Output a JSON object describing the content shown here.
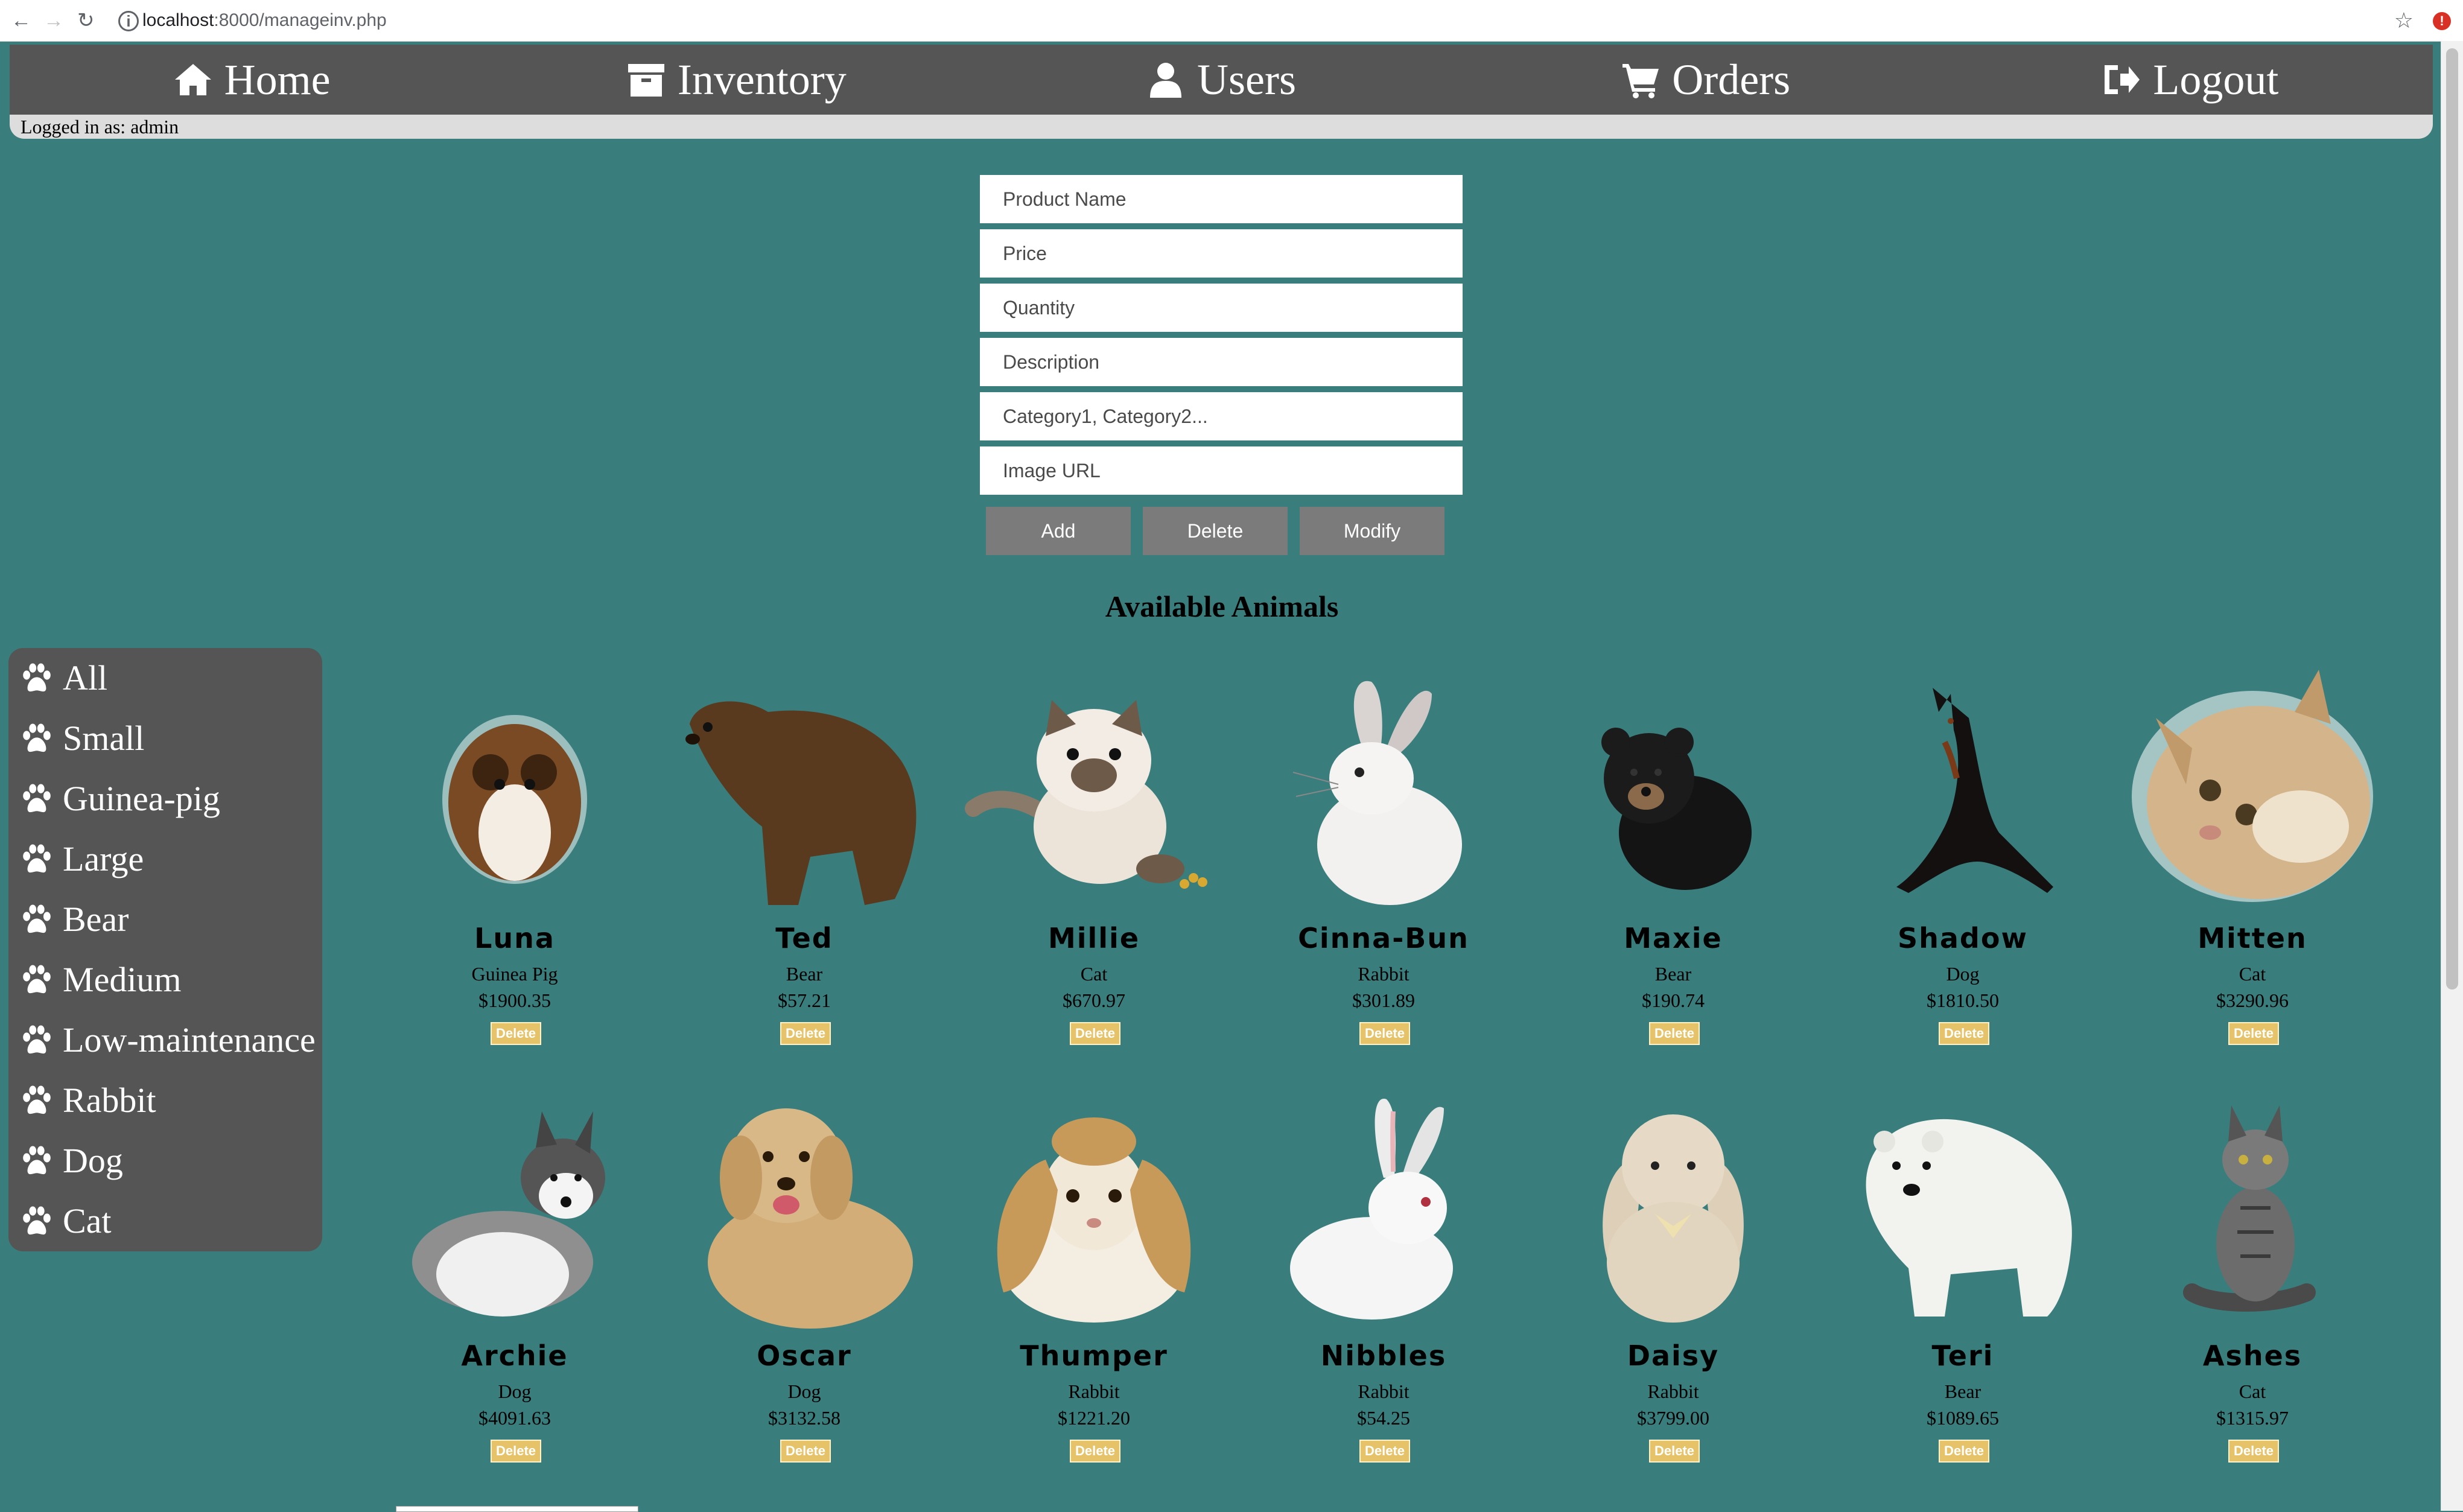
{
  "browser": {
    "url_host": "localhost",
    "url_rest": ":8000/manageinv.php"
  },
  "nav": {
    "items": [
      {
        "label": "Home",
        "icon": "home-icon"
      },
      {
        "label": "Inventory",
        "icon": "archive-icon"
      },
      {
        "label": "Users",
        "icon": "user-icon"
      },
      {
        "label": "Orders",
        "icon": "cart-icon"
      },
      {
        "label": "Logout",
        "icon": "logout-icon"
      }
    ],
    "logged_in": "Logged in as: admin"
  },
  "form": {
    "product_name": {
      "placeholder": "Product Name",
      "value": ""
    },
    "price": {
      "placeholder": "Price",
      "value": ""
    },
    "quantity": {
      "placeholder": "Quantity",
      "value": ""
    },
    "description": {
      "placeholder": "Description",
      "value": ""
    },
    "categories": {
      "placeholder": "Category1, Category2...",
      "value": ""
    },
    "image_url": {
      "placeholder": "Image URL",
      "value": ""
    },
    "add_label": "Add",
    "delete_label": "Delete",
    "modify_label": "Modify"
  },
  "section_title": "Available Animals",
  "sidebar": {
    "items": [
      {
        "label": "All"
      },
      {
        "label": "Small"
      },
      {
        "label": "Guinea-pig"
      },
      {
        "label": "Large"
      },
      {
        "label": "Bear"
      },
      {
        "label": "Medium"
      },
      {
        "label": "Low-maintenance"
      },
      {
        "label": "Rabbit"
      },
      {
        "label": "Dog"
      },
      {
        "label": "Cat"
      }
    ],
    "icon": "paw-icon"
  },
  "animals": [
    {
      "name": "Luna",
      "type": "Guinea Pig",
      "price": "$1900.35",
      "delete_label": "Delete"
    },
    {
      "name": "Ted",
      "type": "Bear",
      "price": "$57.21",
      "delete_label": "Delete"
    },
    {
      "name": "Millie",
      "type": "Cat",
      "price": "$670.97",
      "delete_label": "Delete"
    },
    {
      "name": "Cinna-Bun",
      "type": "Rabbit",
      "price": "$301.89",
      "delete_label": "Delete"
    },
    {
      "name": "Maxie",
      "type": "Bear",
      "price": "$190.74",
      "delete_label": "Delete"
    },
    {
      "name": "Shadow",
      "type": "Dog",
      "price": "$1810.50",
      "delete_label": "Delete"
    },
    {
      "name": "Mitten",
      "type": "Cat",
      "price": "$3290.96",
      "delete_label": "Delete"
    },
    {
      "name": "Archie",
      "type": "Dog",
      "price": "$4091.63",
      "delete_label": "Delete"
    },
    {
      "name": "Oscar",
      "type": "Dog",
      "price": "$3132.58",
      "delete_label": "Delete"
    },
    {
      "name": "Thumper",
      "type": "Rabbit",
      "price": "$1221.20",
      "delete_label": "Delete"
    },
    {
      "name": "Nibbles",
      "type": "Rabbit",
      "price": "$54.25",
      "delete_label": "Delete"
    },
    {
      "name": "Daisy",
      "type": "Rabbit",
      "price": "$3799.00",
      "delete_label": "Delete"
    },
    {
      "name": "Teri",
      "type": "Bear",
      "price": "$1089.65",
      "delete_label": "Delete"
    },
    {
      "name": "Ashes",
      "type": "Cat",
      "price": "$1315.97",
      "delete_label": "Delete"
    }
  ],
  "colors": {
    "page_bg": "#397e7d",
    "nav_bg": "#555555",
    "button_bg": "#7b7b7b",
    "delete_bg": "#e6c268"
  }
}
